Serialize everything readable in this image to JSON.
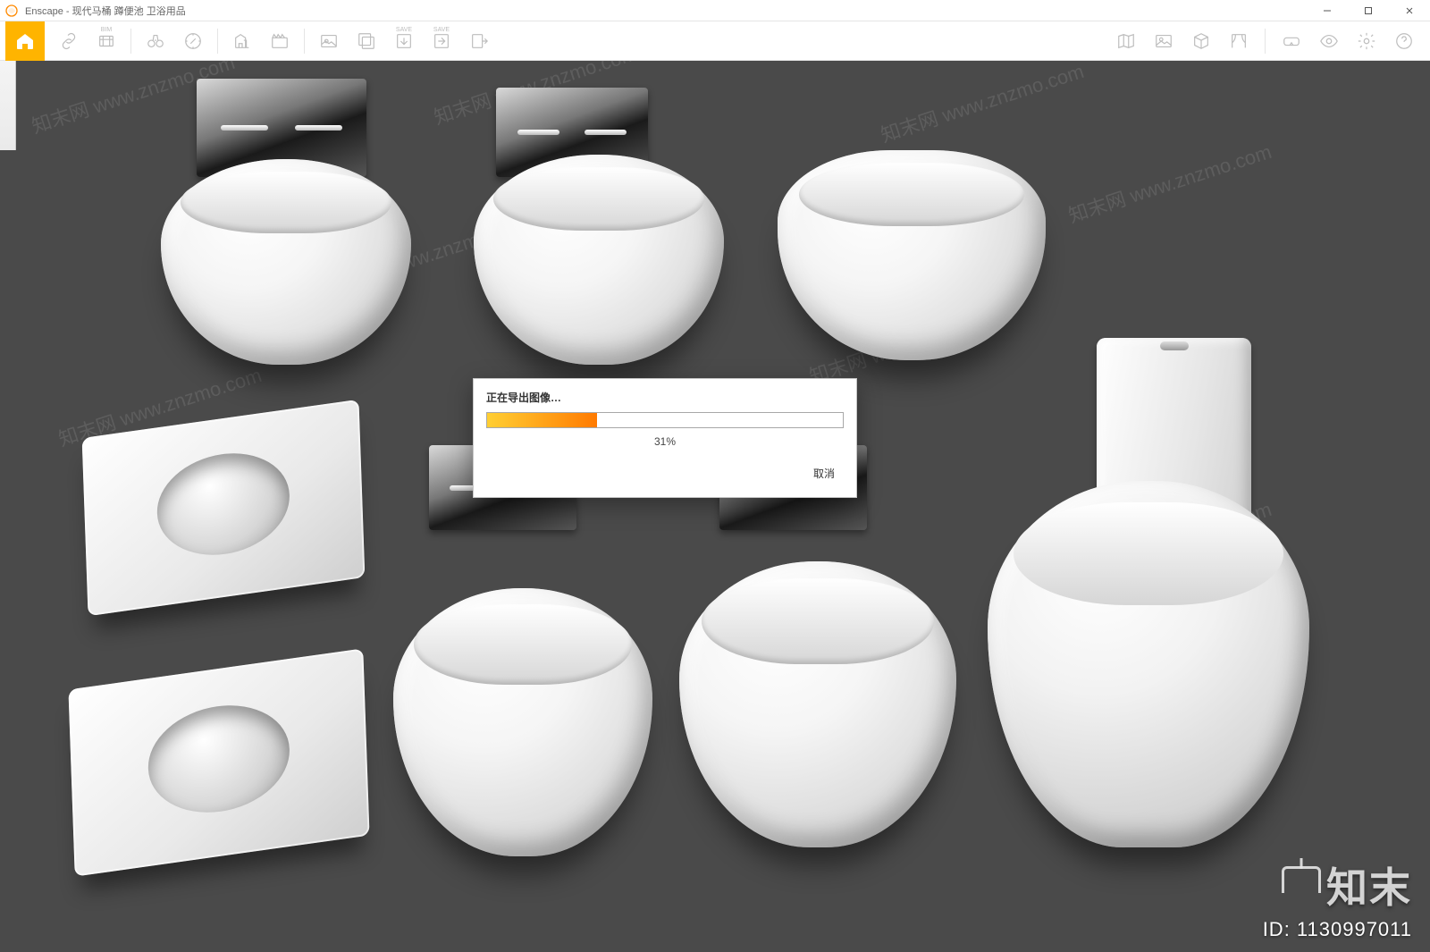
{
  "app": {
    "name": "Enscape",
    "title": "Enscape - 现代马桶 蹲便池 卫浴用品"
  },
  "window_controls": {
    "minimize": "–",
    "maximize": "□",
    "close": "×"
  },
  "toolbar": {
    "home_label": "Home",
    "bim_label": "BIM",
    "save_label": "SAVE",
    "save_label2": "SAVE"
  },
  "dialog": {
    "title": "正在导出图像…",
    "percent_value": 31,
    "percent_text": "31%",
    "cancel": "取消"
  },
  "watermark": {
    "text": "知末网 www.znzmo.com",
    "brand": "知末",
    "id_label": "ID: 1130997011"
  }
}
